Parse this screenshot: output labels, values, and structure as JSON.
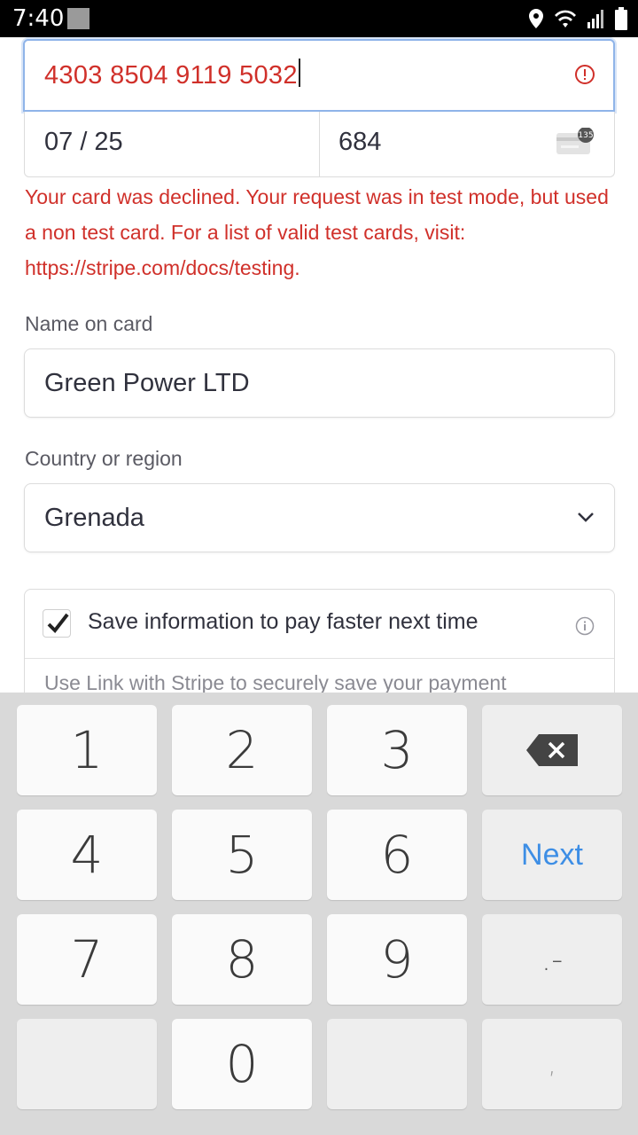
{
  "status_bar": {
    "time": "7:40"
  },
  "card": {
    "number": "4303 8504 9119 5032",
    "expiry": "07 / 25",
    "cvc": "684",
    "cvc_icon_number": "135",
    "error": "Your card was declined. Your request was in test mode, but used a non test card. For a list of valid test cards, visit: https://stripe.com/docs/testing."
  },
  "name_field": {
    "label": "Name on card",
    "value": "Green Power LTD"
  },
  "country_field": {
    "label": "Country or region",
    "value": "Grenada"
  },
  "save_info": {
    "label": "Save information to pay faster next time",
    "checked": true,
    "description": "Use Link with Stripe to securely save your payment"
  },
  "keyboard": {
    "keys": {
      "k1": "1",
      "k2": "2",
      "k3": "3",
      "k4": "4",
      "k5": "5",
      "k6": "6",
      "k7": "7",
      "k8": "8",
      "k9": "9",
      "k0": "0",
      "next": "Next",
      "punct": ".-",
      "comma": ","
    }
  },
  "colors": {
    "error": "#d0302a",
    "focus_border": "#8fb4e9",
    "next_key": "#3d8ee5"
  }
}
